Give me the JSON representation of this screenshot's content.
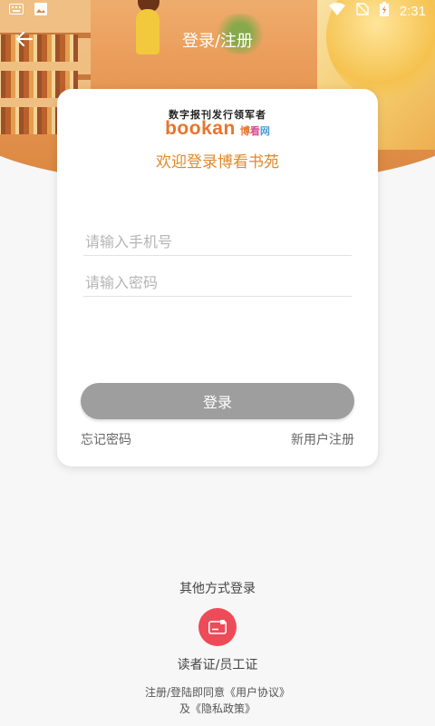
{
  "status_bar": {
    "time": "2:31"
  },
  "nav": {
    "title": "登录/注册"
  },
  "card": {
    "logo_tagline": "数字报刊发行领军者",
    "logo_brand": "bookan",
    "logo_brand_cn": [
      "博",
      "看",
      "网"
    ],
    "welcome": "欢迎登录博看书苑",
    "phone_placeholder": "请输入手机号",
    "password_placeholder": "请输入密码",
    "login_label": "登录",
    "forgot_label": "忘记密码",
    "register_label": "新用户注册"
  },
  "other_login": {
    "title": "其他方式登录",
    "reader_card_label": "读者证/员工证"
  },
  "agreement": {
    "prefix": "注册/登陆即同意",
    "user_agreement": "《用户协议》",
    "and": "及",
    "privacy_policy": "《隐私政策》"
  },
  "colors": {
    "accent_orange": "#e08a2a",
    "brand_orange": "#e8742c",
    "reader_red": "#ee4b59",
    "button_gray": "#9e9e9e"
  },
  "icons": [
    "keyboard-icon",
    "image-icon",
    "wifi-icon",
    "no-sim-icon",
    "battery-icon",
    "back-arrow-icon",
    "id-card-icon"
  ]
}
